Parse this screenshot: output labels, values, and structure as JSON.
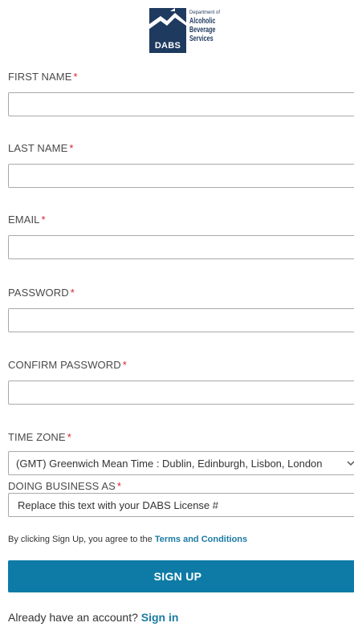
{
  "brand": {
    "short_name": "DABS",
    "line0": "Department of",
    "line1": "Alcoholic",
    "line2": "Beverage",
    "line3": "Services",
    "color": "#1f3a5f"
  },
  "form": {
    "required_marker": "*",
    "first_name": {
      "label": "FIRST NAME",
      "value": ""
    },
    "last_name": {
      "label": "LAST NAME",
      "value": ""
    },
    "email": {
      "label": "EMAIL",
      "value": ""
    },
    "password": {
      "label": "PASSWORD",
      "value": ""
    },
    "confirm_password": {
      "label": "CONFIRM PASSWORD",
      "value": ""
    },
    "time_zone": {
      "label": "TIME ZONE",
      "selected": "(GMT) Greenwich Mean Time : Dublin, Edinburgh, Lisbon, London"
    },
    "doing_business_as": {
      "label": "DOING BUSINESS AS",
      "value": "Replace this text with your DABS License #"
    }
  },
  "agreement": {
    "prefix": "By clicking Sign Up, you agree to the",
    "link": "Terms and Conditions"
  },
  "submit": {
    "label": "SIGN UP",
    "color": "#0e7ba6"
  },
  "signin": {
    "prefix": "Already have an account?",
    "link": "Sign in",
    "link_color": "#1b7aa3"
  }
}
